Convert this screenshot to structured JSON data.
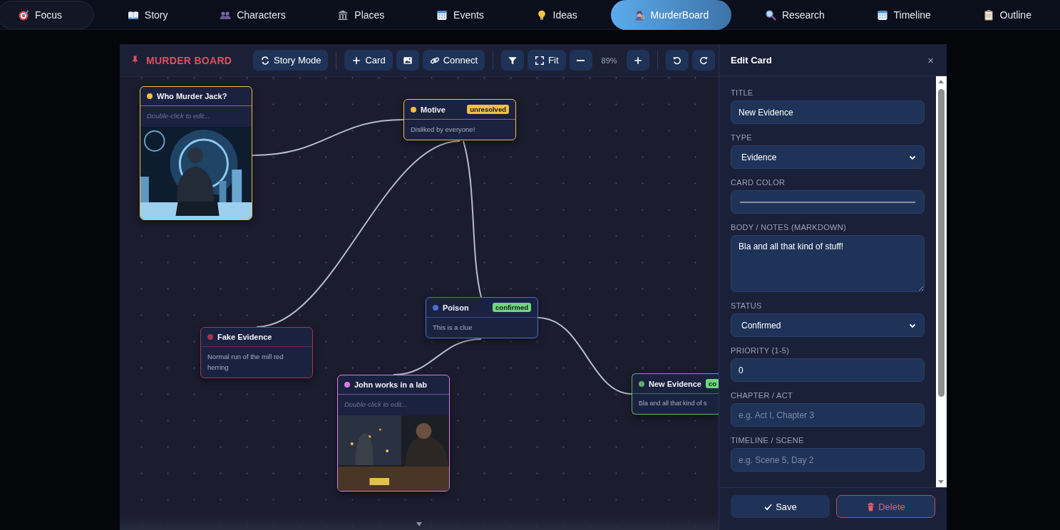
{
  "nav": [
    {
      "label": "Focus",
      "kind": "pill",
      "selected": false
    },
    {
      "label": "Story",
      "kind": "tab",
      "selected": false
    },
    {
      "label": "Characters",
      "kind": "tab",
      "selected": false
    },
    {
      "label": "Places",
      "kind": "tab",
      "selected": false
    },
    {
      "label": "Events",
      "kind": "tab",
      "selected": false
    },
    {
      "label": "Ideas",
      "kind": "tab",
      "selected": false
    },
    {
      "label": "MurderBoard",
      "kind": "tab",
      "selected": true
    },
    {
      "label": "Research",
      "kind": "tab",
      "selected": false
    },
    {
      "label": "Timeline",
      "kind": "tab",
      "selected": false
    },
    {
      "label": "Outline",
      "kind": "tab",
      "selected": false
    }
  ],
  "toolbar": {
    "title": "MURDER BOARD",
    "story_mode": "Story Mode",
    "add_card": "Card",
    "connect": "Connect",
    "fit": "Fit",
    "zoom": "89%"
  },
  "cards": [
    {
      "title": "Who Murder Jack?",
      "color": "#f0c044",
      "placeholder": "Double-click to edit..."
    },
    {
      "title": "Motive",
      "color": "#f0c044",
      "badge": {
        "text": "unresolved",
        "color": "#f0c044"
      },
      "body": "Disliked by everyone!"
    },
    {
      "title": "Poison",
      "color": "#4f6fd0",
      "badge": {
        "text": "confirmed",
        "color": "#6fd67f"
      },
      "body": "This is a clue"
    },
    {
      "title": "Fake Evidence",
      "color": "#a8344f",
      "body": "Normal run of the mill red herring"
    },
    {
      "title": "John works in a lab",
      "color": "#d67ee8",
      "placeholder": "Double-click to edit..."
    },
    {
      "title": "New Evidence",
      "color": "#5faf6a",
      "badge": {
        "text": "co",
        "color": "#6fd67f"
      },
      "body": "Bla and all that kind of s"
    }
  ],
  "panel": {
    "title": "Edit Card",
    "close": "×",
    "fields": [
      {
        "label": "TITLE",
        "kind": "text",
        "value": "New Evidence"
      },
      {
        "label": "TYPE",
        "kind": "select",
        "value": "Evidence"
      },
      {
        "label": "CARD COLOR",
        "kind": "color"
      },
      {
        "label": "BODY / NOTES (MARKDOWN)",
        "kind": "textarea",
        "value": "Bla and all that kind of stuff!"
      },
      {
        "label": "STATUS",
        "kind": "select",
        "value": "Confirmed"
      },
      {
        "label": "PRIORITY (1-5)",
        "kind": "text",
        "value": "0"
      },
      {
        "label": "CHAPTER / ACT",
        "kind": "text",
        "placeholder": "e.g. Act I, Chapter 3"
      },
      {
        "label": "TIMELINE / SCENE",
        "kind": "text",
        "placeholder": "e.g. Scene 5, Day 2"
      }
    ],
    "save": "Save",
    "delete": "Delete"
  }
}
